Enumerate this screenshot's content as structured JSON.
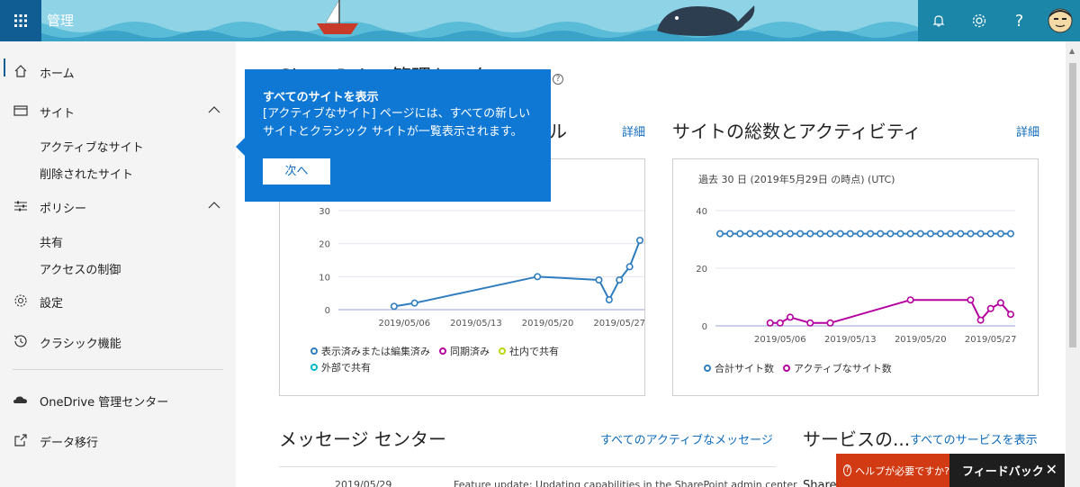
{
  "topbar": {
    "app_title": "管理",
    "icons": [
      "waffle-icon",
      "bell-icon",
      "gear-icon",
      "help-icon",
      "avatar"
    ],
    "help_label": "?"
  },
  "sidebar": {
    "home": "ホーム",
    "sites": "サイト",
    "active_sites": "アクティブなサイト",
    "deleted_sites": "削除されたサイト",
    "policies": "ポリシー",
    "sharing": "共有",
    "access_control": "アクセスの制御",
    "settings": "設定",
    "classic": "クラシック機能",
    "onedrive": "OneDrive 管理センター",
    "migration": "データ移行"
  },
  "main": {
    "page_title": "SharePoint 管理センター",
    "card1_title": "ル",
    "card1_link": "詳細",
    "card2_title": "サイトの総数とアクティビティ",
    "card2_link": "詳細",
    "card2_note": "過去 30 日 (2019年5月29日 の時点) (UTC)",
    "msg_title": "メッセージ センター",
    "msg_link": "すべてのアクティブなメッセージ",
    "svc_title": "サービスの...",
    "svc_link": "すべてのサービスを表示",
    "msg_date": "2019/05/29",
    "msg_text": "Feature update: Updating capabilities in the SharePoint admin center",
    "svc_frag": "Share"
  },
  "bubble": {
    "title": "すべてのサイトを表示",
    "body": "[アクティブなサイト] ページには、すべての新しいサイトとクラシック サイトが一覧表示されます。",
    "next": "次へ"
  },
  "help": {
    "label": "ヘルプが必要ですか?",
    "feedback": "フィードバック",
    "close": "✕"
  },
  "chart_data": [
    {
      "type": "line",
      "title": "",
      "ylim": [
        0,
        30
      ],
      "yticks": [
        "30",
        "20",
        "10",
        "0"
      ],
      "xticks": [
        "2019/05/06",
        "2019/05/13",
        "2019/05/20",
        "2019/05/27"
      ],
      "series": [
        {
          "name": "表示済みまたは編集済み",
          "color": "#2f7dbf",
          "x": [
            "2019/05/05",
            "2019/05/07",
            "2019/05/19",
            "2019/05/25",
            "2019/05/26",
            "2019/05/27",
            "2019/05/28",
            "2019/05/29"
          ],
          "values": [
            1,
            2,
            10,
            9,
            3,
            9,
            13,
            21
          ]
        }
      ],
      "legend": [
        {
          "name": "表示済みまたは編集済み",
          "color": "#2f7dbf"
        },
        {
          "name": "同期済み",
          "color": "#b4009e"
        },
        {
          "name": "社内で共有",
          "color": "#bad80a"
        },
        {
          "name": "外部で共有",
          "color": "#00b7c3"
        }
      ]
    },
    {
      "type": "line",
      "title": "",
      "ylim": [
        0,
        40
      ],
      "yticks": [
        "40",
        "20",
        "0"
      ],
      "xticks": [
        "2019/05/06",
        "2019/05/13",
        "2019/05/20",
        "2019/05/27"
      ],
      "series": [
        {
          "name": "合計サイト数",
          "color": "#2f7dbf",
          "x": [
            "2019/04/30",
            "2019/05/01",
            "2019/05/02",
            "2019/05/03",
            "2019/05/04",
            "2019/05/05",
            "2019/05/06",
            "2019/05/07",
            "2019/05/08",
            "2019/05/09",
            "2019/05/10",
            "2019/05/11",
            "2019/05/12",
            "2019/05/13",
            "2019/05/14",
            "2019/05/15",
            "2019/05/16",
            "2019/05/17",
            "2019/05/18",
            "2019/05/19",
            "2019/05/20",
            "2019/05/21",
            "2019/05/22",
            "2019/05/23",
            "2019/05/24",
            "2019/05/25",
            "2019/05/26",
            "2019/05/27",
            "2019/05/28",
            "2019/05/29"
          ],
          "values": [
            32,
            32,
            32,
            32,
            32,
            32,
            32,
            32,
            32,
            32,
            32,
            32,
            32,
            32,
            32,
            32,
            32,
            32,
            32,
            32,
            32,
            32,
            32,
            32,
            32,
            32,
            32,
            32,
            32,
            32
          ]
        },
        {
          "name": "アクティブなサイト数",
          "color": "#b4009e",
          "x": [
            "2019/05/05",
            "2019/05/06",
            "2019/05/07",
            "2019/05/09",
            "2019/05/11",
            "2019/05/19",
            "2019/05/25",
            "2019/05/26",
            "2019/05/27",
            "2019/05/28",
            "2019/05/29"
          ],
          "values": [
            1,
            1,
            3,
            1,
            1,
            9,
            9,
            2,
            6,
            8,
            4
          ]
        }
      ],
      "legend": [
        {
          "name": "合計サイト数",
          "color": "#2f7dbf"
        },
        {
          "name": "アクティブなサイト数",
          "color": "#b4009e"
        }
      ]
    }
  ]
}
